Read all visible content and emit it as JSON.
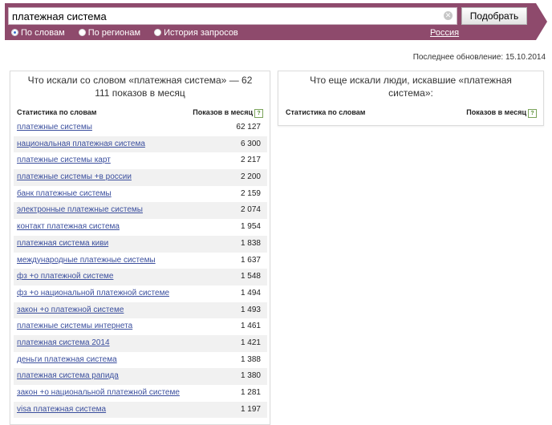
{
  "search": {
    "query": "платежная система",
    "submit_label": "Подобрать",
    "modes": [
      {
        "label": "По словам",
        "selected": true
      },
      {
        "label": "По регионам",
        "selected": false
      },
      {
        "label": "История запросов",
        "selected": false
      }
    ],
    "region": "Россия"
  },
  "updated": "Последнее обновление: 15.10.2014",
  "left_panel": {
    "title": "Что искали со словом «платежная система» — 62 111 показов в месяц",
    "col_words": "Статистика по словам",
    "col_shows": "Показов в месяц",
    "help": "?",
    "rows": [
      {
        "phrase": "платежные системы",
        "count": "62 127"
      },
      {
        "phrase": "национальная платежная система",
        "count": "6 300"
      },
      {
        "phrase": "платежные системы карт",
        "count": "2 217"
      },
      {
        "phrase": "платежные системы +в россии",
        "count": "2 200"
      },
      {
        "phrase": "банк платежные системы",
        "count": "2 159"
      },
      {
        "phrase": "электронные платежные системы",
        "count": "2 074"
      },
      {
        "phrase": "контакт платежная система",
        "count": "1 954"
      },
      {
        "phrase": "платежная система киви",
        "count": "1 838"
      },
      {
        "phrase": "международные платежные системы",
        "count": "1 637"
      },
      {
        "phrase": "фз +о платежной системе",
        "count": "1 548"
      },
      {
        "phrase": "фз +о национальной платежной системе",
        "count": "1 494"
      },
      {
        "phrase": "закон +о платежной системе",
        "count": "1 493"
      },
      {
        "phrase": "платежные системы интернета",
        "count": "1 461"
      },
      {
        "phrase": "платежная система 2014",
        "count": "1 421"
      },
      {
        "phrase": "деньги платежная система",
        "count": "1 388"
      },
      {
        "phrase": "платежная система рапида",
        "count": "1 380"
      },
      {
        "phrase": "закон +о национальной платежной системе",
        "count": "1 281"
      },
      {
        "phrase": "visa платежная система",
        "count": "1 197"
      }
    ]
  },
  "right_panel": {
    "title": "Что еще искали люди, искавшие «платежная система»:",
    "col_words": "Статистика по словам",
    "col_shows": "Показов в месяц",
    "help": "?"
  },
  "colors": {
    "banner": "#8e4a6c",
    "link": "#3b4f9e",
    "selected_radio": "#3a6fd0"
  },
  "icons": {
    "clear": "clear-icon",
    "help": "help-icon"
  }
}
